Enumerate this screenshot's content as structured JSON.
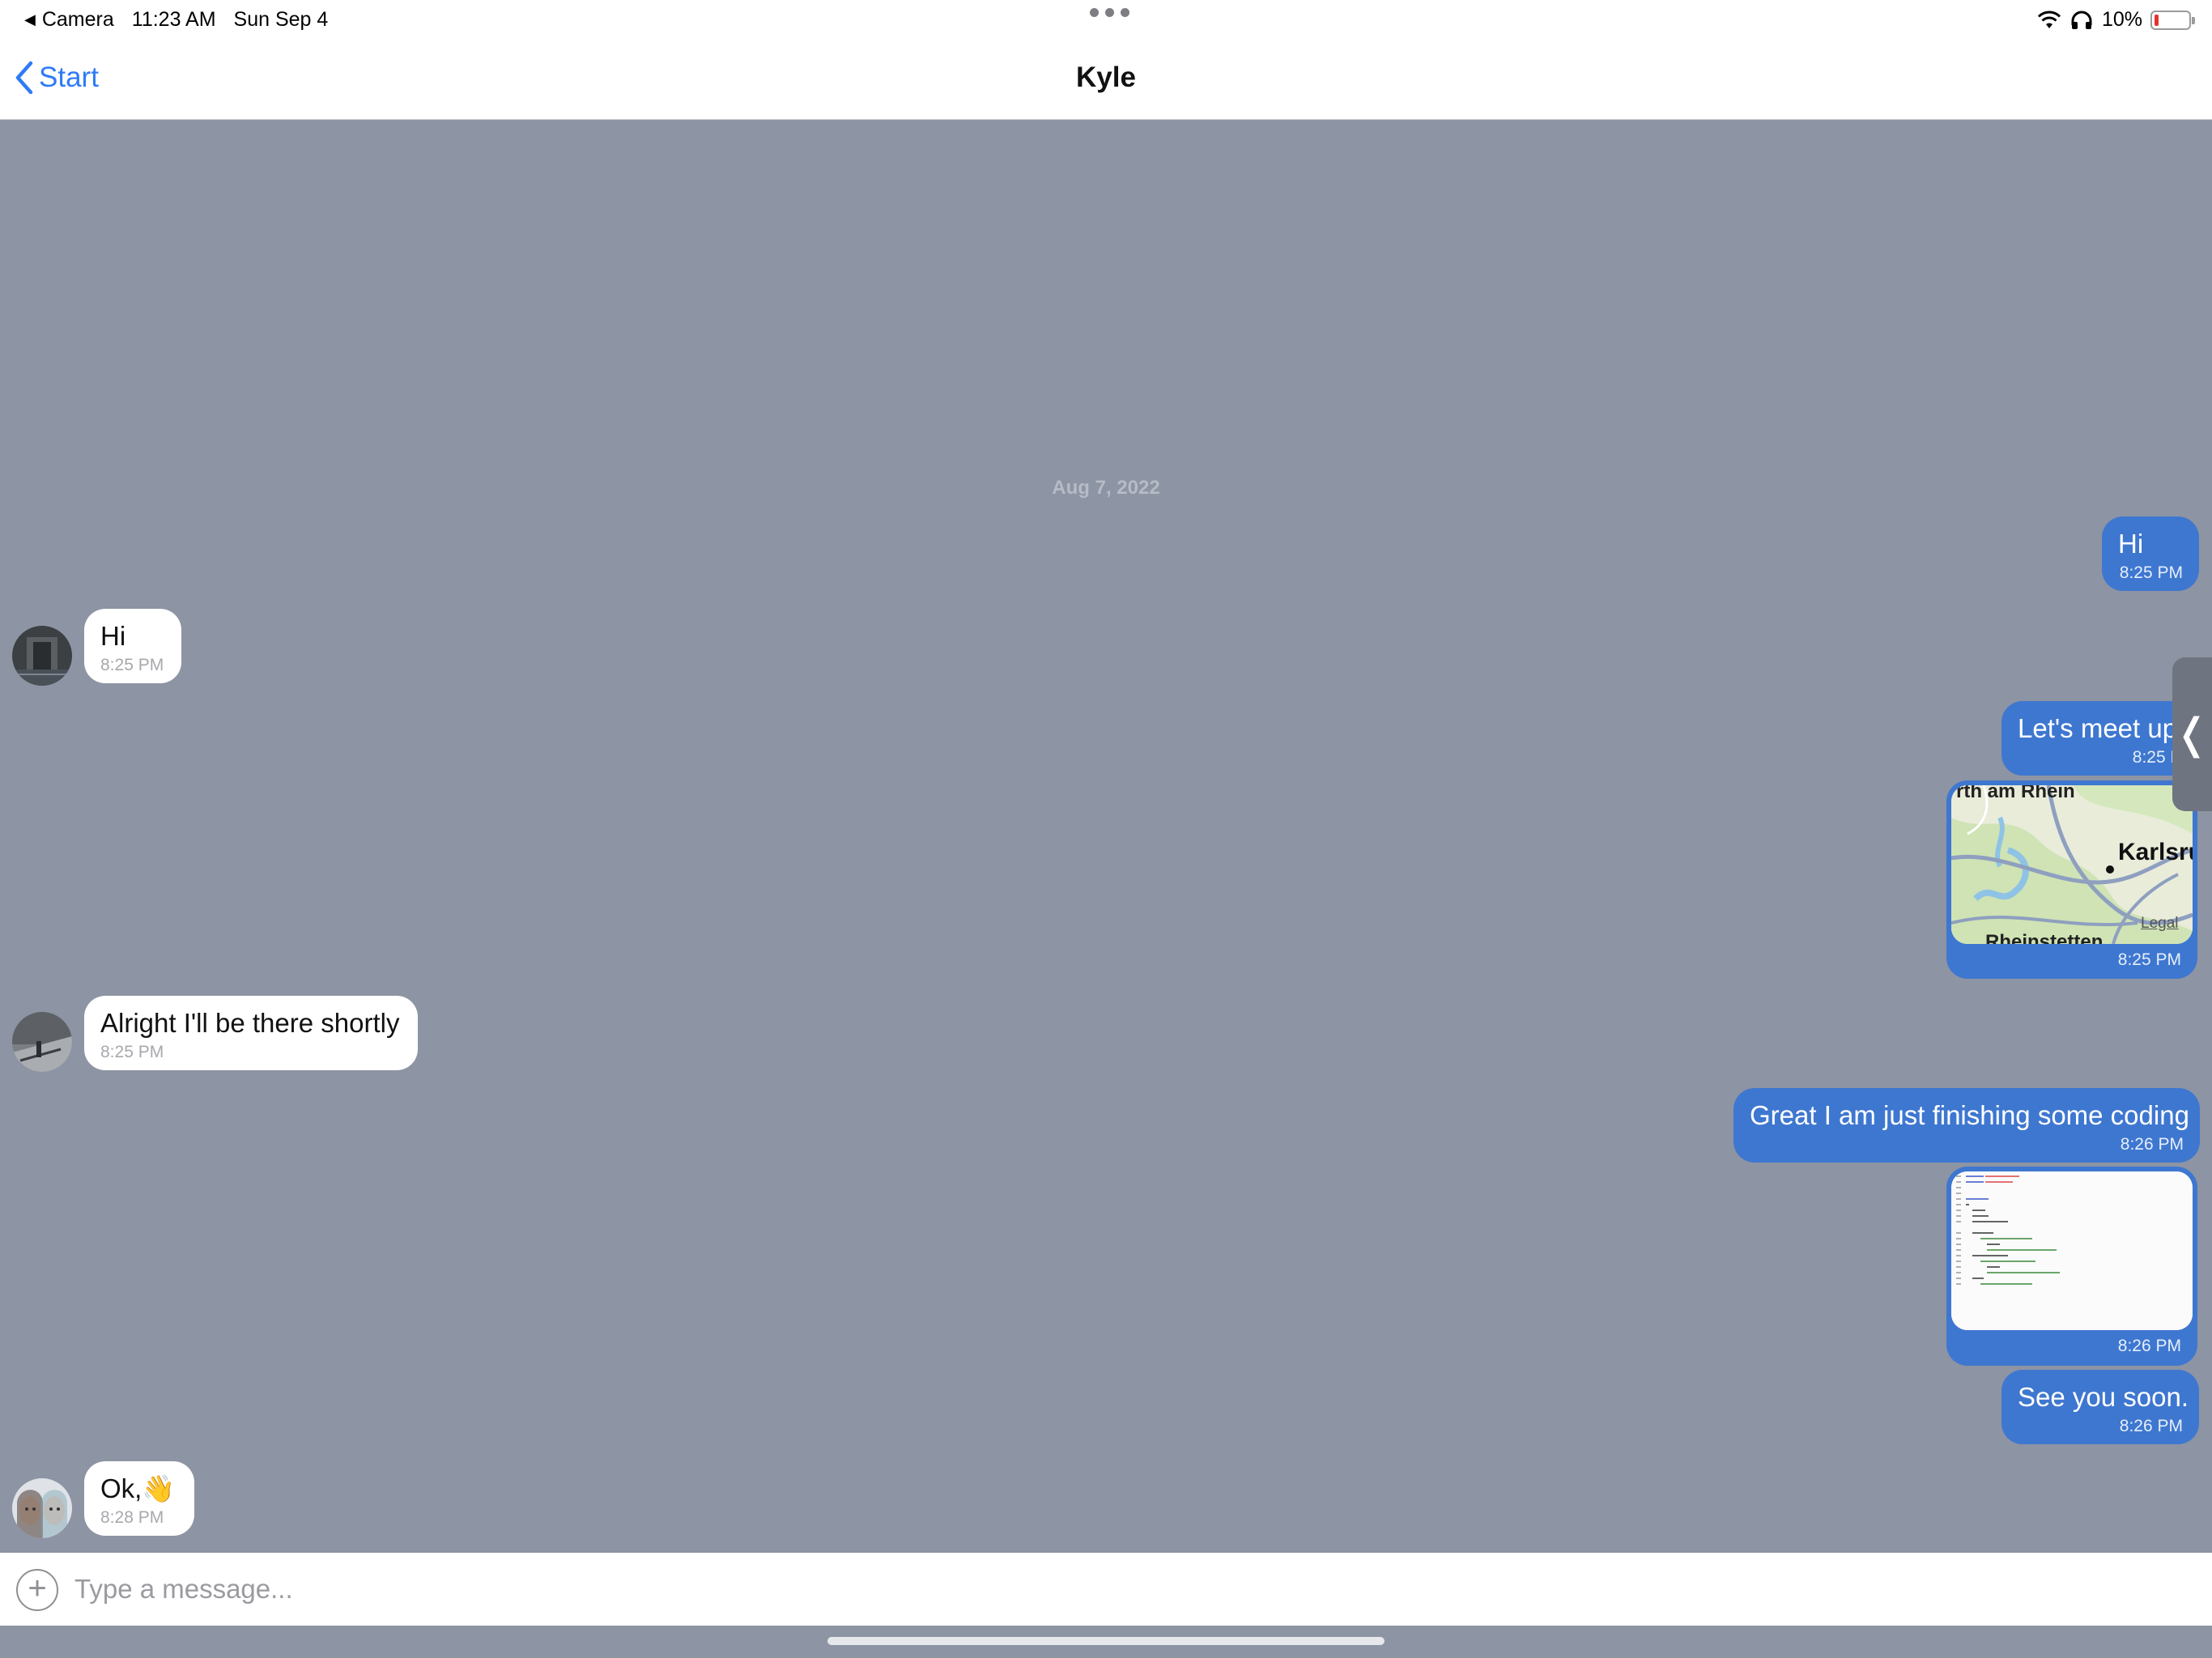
{
  "status_bar": {
    "back_app": "Camera",
    "time": "11:23 AM",
    "date": "Sun Sep 4",
    "battery": "10%",
    "battery_level": 0.1,
    "icons": [
      "wifi-icon",
      "headphones-icon",
      "battery-icon"
    ]
  },
  "nav": {
    "back_label": "Start",
    "title": "Kyle"
  },
  "chat": {
    "date_separator": "Aug 7, 2022",
    "messages": [
      {
        "direction": "out",
        "text": "Hi",
        "time": "8:25 PM"
      },
      {
        "direction": "in",
        "text": "Hi",
        "time": "8:25 PM"
      },
      {
        "direction": "out",
        "text": "Let's meet up",
        "time": "8:25 PM"
      },
      {
        "direction": "out",
        "type": "map",
        "map_labels": [
          "rth am Rhein",
          "Karlsru",
          "Rheinstetten",
          "Legal"
        ],
        "time": "8:25 PM"
      },
      {
        "direction": "in",
        "text": "Alright I'll be there shortly",
        "time": "8:25 PM"
      },
      {
        "direction": "out",
        "text": "Great I am just finishing some coding",
        "time": "8:26 PM"
      },
      {
        "direction": "out",
        "type": "image",
        "time": "8:26 PM"
      },
      {
        "direction": "out",
        "text": "See you soon.",
        "time": "8:26 PM"
      },
      {
        "direction": "in",
        "text": "Ok,👋",
        "time": "8:28 PM"
      }
    ]
  },
  "composer": {
    "placeholder": "Type a message..."
  },
  "colors": {
    "background": "#8d94a3",
    "outgoing_bubble": "#3e77d0",
    "incoming_bubble": "#ffffff",
    "accent": "#2f7bf6"
  }
}
